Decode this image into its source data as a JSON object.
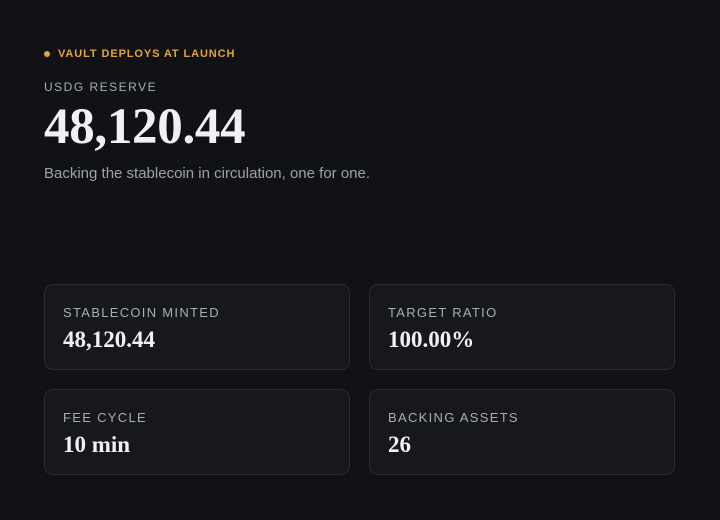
{
  "status": {
    "label": "VAULT DEPLOYS AT LAUNCH",
    "color": "#e2a43a"
  },
  "reserve": {
    "label": "USDG RESERVE",
    "value": "48,120.44",
    "description": "Backing the stablecoin in circulation, one for one."
  },
  "cards": [
    {
      "label": "STABLECOIN MINTED",
      "value": "48,120.44"
    },
    {
      "label": "TARGET RATIO",
      "value": "100.00%"
    },
    {
      "label": "FEE CYCLE",
      "value": "10 min"
    },
    {
      "label": "BACKING ASSETS",
      "value": "26"
    }
  ]
}
